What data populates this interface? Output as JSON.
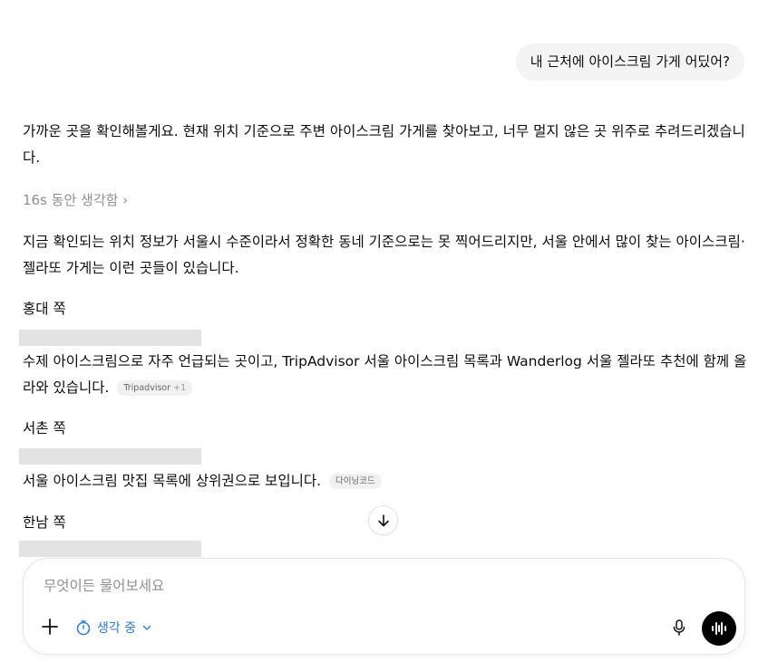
{
  "user_message": "내 근처에 아이스크림 가게 어딨어?",
  "assistant": {
    "intro": "가까운 곳을 확인해볼게요. 현재 위치 기준으로 주변 아이스크림 가게를 찾아보고, 너무 멀지 않은 곳 위주로 추려드리겠습니다.",
    "thinking_label": "16s 동안 생각함",
    "thinking_chevron": "›",
    "summary": "지금 확인되는 위치 정보가 서울시 수준이라서 정확한 동네 기준으로는 못 찍어드리지만, 서울 안에서 많이 찾는 아이스크림·젤라또 가게는 이런 곳들이 있습니다.",
    "sections": [
      {
        "heading": "홍대 쪽",
        "text": "수제 아이스크림으로 자주 언급되는 곳이고, TripAdvisor 서울 아이스크림 목록과 Wanderlog 서울 젤라또 추천에 함께 올라와 있습니다.",
        "chip": "Tripadvisor",
        "chip_extra": "+1"
      },
      {
        "heading": "서촌 쪽",
        "text": "서울 아이스크림 맛집 목록에 상위권으로 보입니다.",
        "chip": "다이닝코드"
      },
      {
        "heading": "한남 쪽"
      }
    ]
  },
  "composer": {
    "placeholder": "무엇이든 물어보세요",
    "thinking_mode_label": "생각 중"
  },
  "icons": {
    "scroll_down": "arrow-down-icon",
    "plus": "plus-icon",
    "timer": "timer-icon",
    "chevron": "chevron-down-icon",
    "mic": "mic-icon",
    "voice": "voice-wave-icon"
  },
  "colors": {
    "accent": "#2f7ae5",
    "muted_text": "#8f8f8f",
    "bubble_bg": "#f4f4f4",
    "redaction": "#e3e3e3"
  }
}
